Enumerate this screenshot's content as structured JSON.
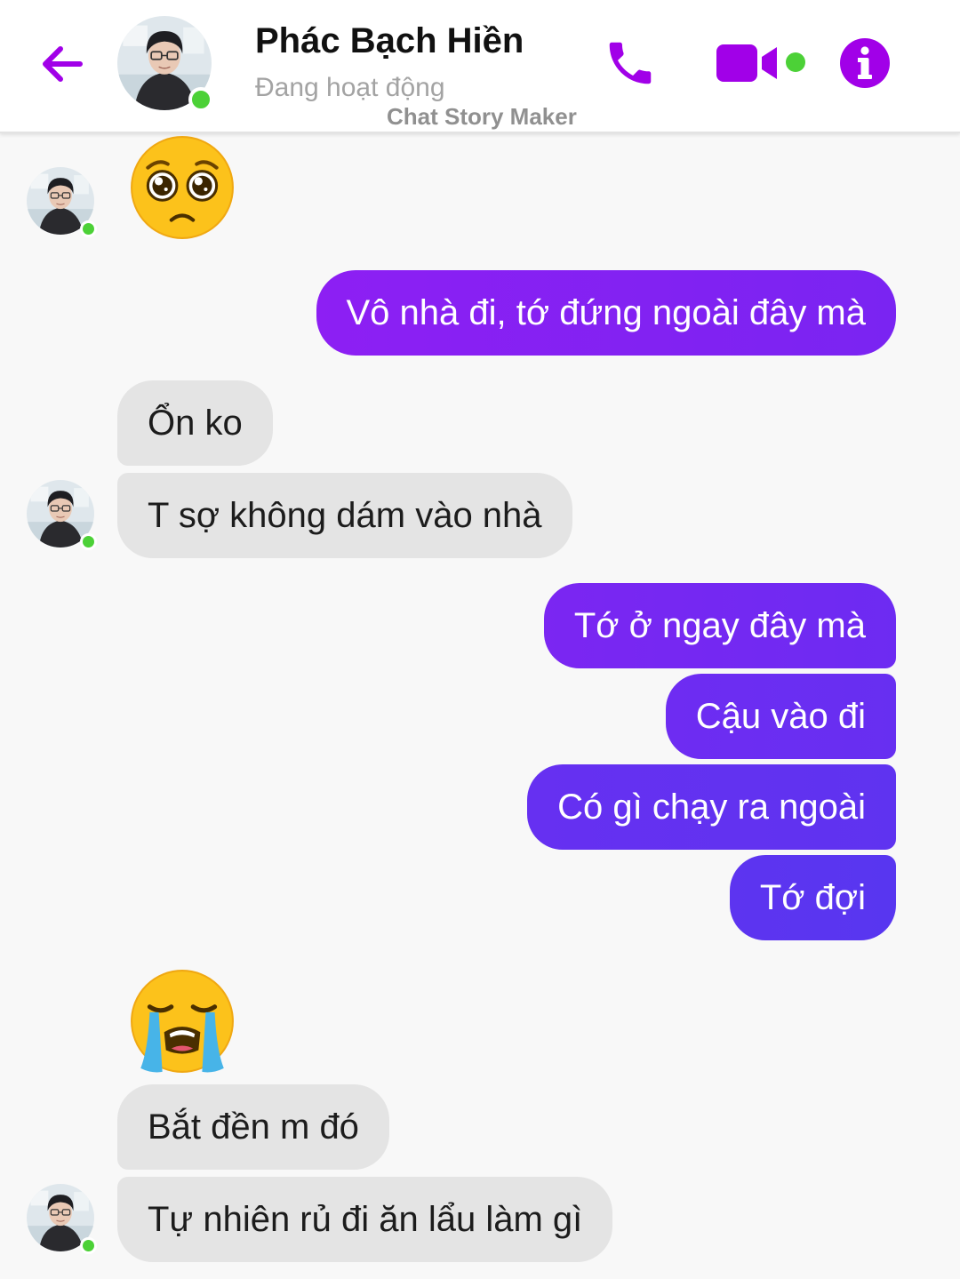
{
  "header": {
    "name": "Phác Bạch Hiền",
    "status": "Đang hoạt động",
    "watermark": "Chat Story Maker",
    "icons": {
      "back": "arrow-left-icon",
      "call": "phone-icon",
      "video": "video-camera-icon",
      "info": "info-icon"
    },
    "accent_color": "#a100e8",
    "online_color": "#4cd137"
  },
  "messages": [
    {
      "side": "in",
      "type": "emoji",
      "emoji": "pleading-face"
    },
    {
      "side": "out",
      "text": "Vô nhà đi, tớ đứng ngoài đây mà"
    },
    {
      "side": "in",
      "text": "Ổn ko"
    },
    {
      "side": "in",
      "text": "T sợ không dám vào nhà"
    },
    {
      "side": "out",
      "text": "Tớ ở ngay đây mà"
    },
    {
      "side": "out",
      "text": "Cậu vào đi"
    },
    {
      "side": "out",
      "text": "Có gì chạy ra ngoài"
    },
    {
      "side": "out",
      "text": "Tớ đợi"
    },
    {
      "side": "in",
      "type": "emoji",
      "emoji": "loudly-crying-face"
    },
    {
      "side": "in",
      "text": "Bắt đền m đó"
    },
    {
      "side": "in",
      "text": "Tự nhiên rủ đi ăn lẩu làm gì"
    }
  ],
  "colors": {
    "outgoing_gradient": [
      "#8a1ff3",
      "#6b2cf2",
      "#5a34f0"
    ],
    "incoming_bubble": "#e4e4e4",
    "background": "#f8f8f8"
  }
}
